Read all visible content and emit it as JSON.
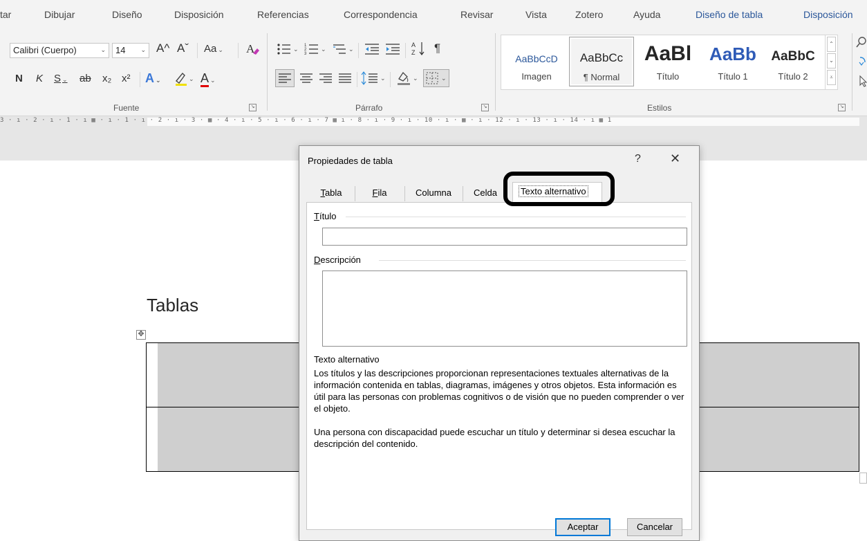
{
  "ribbon_tabs": [
    {
      "label": "tar",
      "blue": false
    },
    {
      "label": "Dibujar",
      "blue": false
    },
    {
      "label": "Diseño",
      "blue": false
    },
    {
      "label": "Disposición",
      "blue": false
    },
    {
      "label": "Referencias",
      "blue": false
    },
    {
      "label": "Correspondencia",
      "blue": false
    },
    {
      "label": "Revisar",
      "blue": false
    },
    {
      "label": "Vista",
      "blue": false
    },
    {
      "label": "Zotero",
      "blue": false
    },
    {
      "label": "Ayuda",
      "blue": false
    },
    {
      "label": "Diseño de tabla",
      "blue": true
    },
    {
      "label": "Disposición",
      "blue": true
    }
  ],
  "font_group": {
    "font_name": "Calibri (Cuerpo)",
    "font_size": "14",
    "grow_font": "A^",
    "shrink_font": "Aˇ",
    "change_case": "Aa",
    "bold": "N",
    "italic": "K",
    "underline": "S",
    "strikethrough": "ab",
    "subscript": "x₂",
    "superscript": "x²",
    "text_effects": "A",
    "font_color": "A",
    "label": "Fuente"
  },
  "paragraph_group": {
    "sort": "A↓Z",
    "pilcrow": "¶",
    "label": "Párrafo"
  },
  "styles_group": {
    "label": "Estilos",
    "items": [
      {
        "preview": "AaBbCcD",
        "name": "Imagen"
      },
      {
        "preview": "AaBbCc",
        "name": "¶ Normal"
      },
      {
        "preview": "AaBl",
        "name": "Título"
      },
      {
        "preview": "AaBb",
        "name": "Título 1"
      },
      {
        "preview": "AaBbC",
        "name": "Título 2"
      }
    ]
  },
  "ruler": {
    "marks": "3 · ı · 2 · ı · 1 · ı ▦   · ı · 1 · ı · 2 · ı · 3 · ▦ · 4 · ı · 5 · ı · 6 · ı · 7 ▦ ı · 8 · ı · 9 · ı · 10 · ı · ▦ · ı · 12 · ı · 13 · ı · 14 · ı ▦ 1"
  },
  "colors": {
    "accent_blue": "#2b579a",
    "font_color_red": "#e00000",
    "highlight_ring": "#000000",
    "table_fill": "#cfcfcf",
    "default_button_border": "#0078d7"
  },
  "document": {
    "heading": "Tablas",
    "move_handle_icon": "✥"
  },
  "dialog": {
    "title": "Propiedades de tabla",
    "help": "?",
    "close": "✕",
    "tabs": [
      {
        "first": "T",
        "rest": "abla"
      },
      {
        "first": "F",
        "rest": "ila"
      },
      {
        "first": "Col",
        "rest": "umna",
        "underline_index": 1
      },
      {
        "first": "Ce",
        "rest": "lda"
      }
    ],
    "active_tab": "Texto alternativo",
    "title_field": {
      "label_first": "T",
      "label_rest": "ítulo",
      "value": ""
    },
    "description_field": {
      "label_first": "D",
      "label_rest": "escripción",
      "value": ""
    },
    "info_heading": "Texto alternativo",
    "info_paragraph_1": "Los títulos y las descripciones proporcionan representaciones textuales alternativas de la información contenida en tablas, diagramas, imágenes y otros objetos. Esta información es útil para las personas con problemas cognitivos o de visión que no pueden comprender o ver el objeto.",
    "info_paragraph_2": "Una persona con discapacidad puede escuchar un título y determinar si desea escuchar la descripción del contenido.",
    "ok_label": "Aceptar",
    "cancel_label": "Cancelar"
  }
}
